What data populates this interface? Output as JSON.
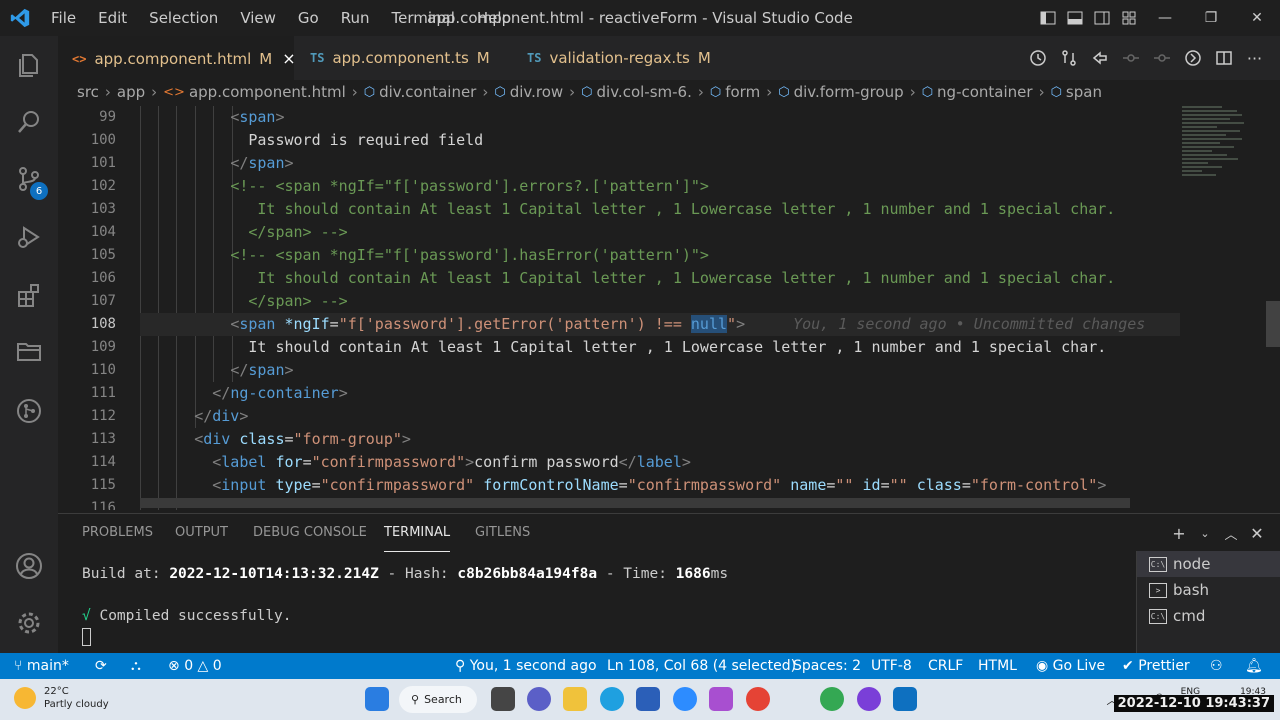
{
  "window": {
    "title": "app.component.html - reactiveForm - Visual Studio Code",
    "menu": [
      "File",
      "Edit",
      "Selection",
      "View",
      "Go",
      "Run",
      "Terminal",
      "Help"
    ]
  },
  "activity_bar": {
    "items": [
      "explorer-icon",
      "search-icon",
      "source-control-icon",
      "run-debug-icon",
      "extensions-icon",
      "folder-icon",
      "gitlens-icon",
      "account-icon",
      "manage-gear-icon"
    ],
    "scm_badge": "6"
  },
  "tabs": [
    {
      "icon": "<>",
      "label": "app.component.html",
      "modified": "M",
      "close": "×",
      "active": true
    },
    {
      "icon": "TS",
      "label": "app.component.ts",
      "modified": "M",
      "active": false
    },
    {
      "icon": "TS",
      "label": "validation-regax.ts",
      "modified": "M",
      "active": false
    }
  ],
  "breadcrumb": [
    "src",
    "app",
    "app.component.html",
    "div.container",
    "div.row",
    "div.col-sm-6.",
    "form",
    "div.form-group",
    "ng-container",
    "span"
  ],
  "editor": {
    "line_numbers": [
      "99",
      "100",
      "101",
      "102",
      "103",
      "104",
      "105",
      "106",
      "107",
      "108",
      "109",
      "110",
      "111",
      "112",
      "113",
      "114",
      "115",
      "116"
    ],
    "active_line": "108",
    "blame": "You, 1 second ago • Uncommitted changes",
    "lines": {
      "l99_tag": "span",
      "l100_text": "Password is required field",
      "l101_tag": "span",
      "l102": "<!-- <span *ngIf=\"f['password'].errors?.['pattern']\">",
      "l103": "It should contain At least 1 Capital letter , 1 Lowercase letter , 1 number and 1 special char.",
      "l104": "</span> -->",
      "l105": "<!-- <span *ngIf=\"f['password'].hasError('pattern')\">",
      "l106": "It should contain At least 1 Capital letter , 1 Lowercase letter , 1 number and 1 special char.",
      "l107": "</span> -->",
      "l108_tag": "span",
      "l108_attr": "*ngIf",
      "l108_val1": "\"f[",
      "l108_s1": "'password'",
      "l108_val2": "].getError(",
      "l108_s2": "'pattern'",
      "l108_val3": ") !== ",
      "l108_sel": "null",
      "l108_val4": "\"",
      "l109_text": "It should contain At least 1 Capital letter , 1 Lowercase letter , 1 number and 1 special char.",
      "l110_tag": "span",
      "l111_tag": "ng-container",
      "l112_tag": "div",
      "l113_tag": "div",
      "l113_attr": "class",
      "l113_val": "\"form-group\"",
      "l114_tag": "label",
      "l114_attr": "for",
      "l114_val": "\"confirmpassword\"",
      "l114_text": "confirm password",
      "l114_close": "label",
      "l115_tag": "input",
      "l115_a1": "type",
      "l115_v1": "\"confirmpassword\"",
      "l115_a2": "formControlName",
      "l115_v2": "\"confirmpassword\"",
      "l115_a3": "name",
      "l115_v3": "\"\"",
      "l115_a4": "id",
      "l115_v4": "\"\"",
      "l115_a5": "class",
      "l115_v5": "\"form-control\"",
      "l115_end": ">"
    }
  },
  "panel": {
    "tabs": [
      "PROBLEMS",
      "OUTPUT",
      "DEBUG CONSOLE",
      "TERMINAL",
      "GITLENS"
    ],
    "active_tab": "TERMINAL",
    "terminal": {
      "build_label": "Build at: ",
      "build_time": "2022-12-10T14:13:32.214Z",
      "hash_label": " - Hash: ",
      "hash": "c8b26bb84a194f8a",
      "time_label": " - Time: ",
      "time_value": "1686",
      "time_unit": "ms",
      "check": "√",
      "compiled": " Compiled successfully."
    },
    "terminal_list": [
      {
        "icon": "C:\\",
        "label": "node",
        "active": true
      },
      {
        "icon": ">",
        "label": "bash",
        "active": false
      },
      {
        "icon": "C:\\",
        "label": "cmd",
        "active": false
      }
    ]
  },
  "status_bar": {
    "branch": "main*",
    "errors": "0",
    "warnings": "0",
    "blame": "You, 1 second ago",
    "position": "Ln 108, Col 68 (4 selected)",
    "spaces": "Spaces: 2",
    "encoding": "UTF-8",
    "eol": "CRLF",
    "language": "HTML",
    "golive": "Go Live",
    "prettier": "Prettier"
  },
  "taskbar": {
    "temperature": "22°C",
    "weather": "Partly cloudy",
    "search": "Search",
    "lang": "ENG",
    "clock_time": "19:43",
    "clock_overlay": "2022-12-10 19:43:37"
  },
  "colors": {
    "accent": "#007acc",
    "editor_bg": "#1e1e1e",
    "modified": "#e2c08d",
    "selection": "#264f78"
  }
}
